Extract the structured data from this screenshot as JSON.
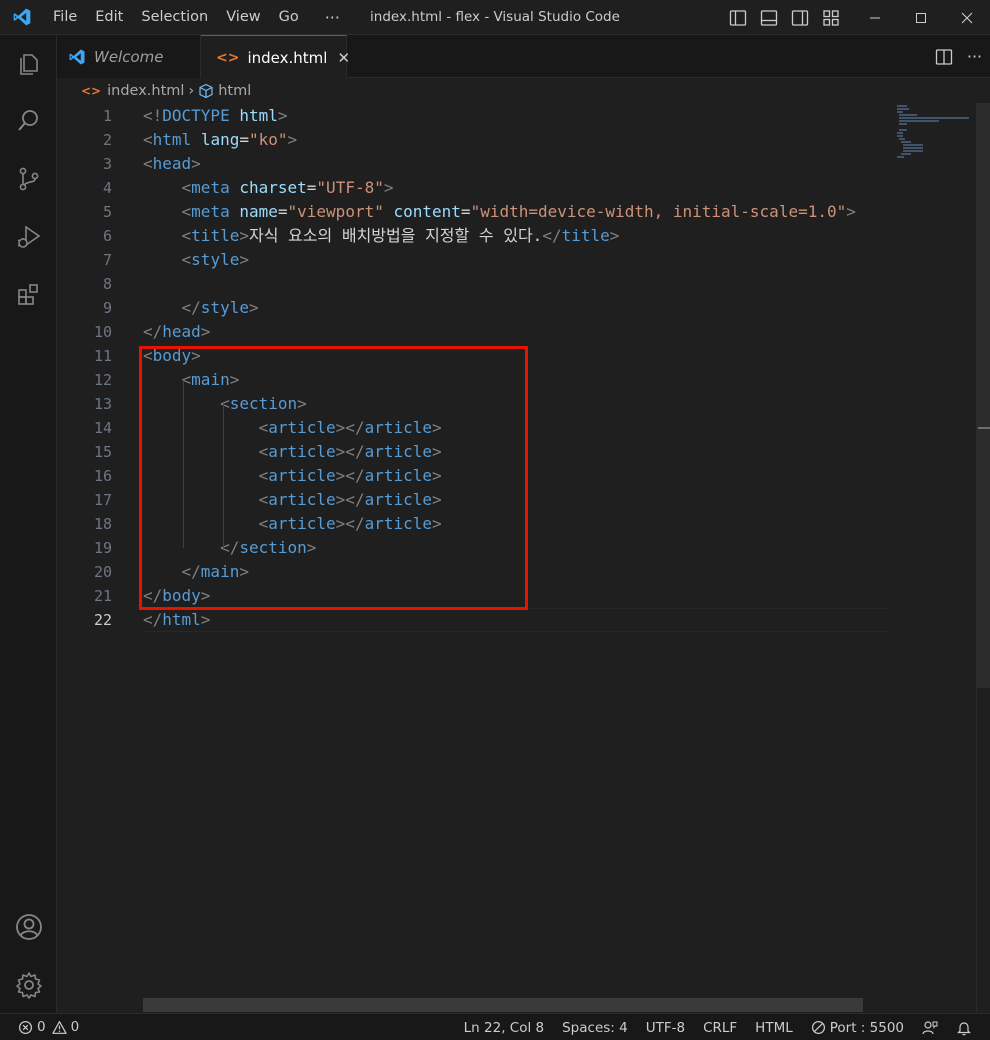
{
  "window": {
    "title": "index.html - flex - Visual Studio Code",
    "menu": [
      "File",
      "Edit",
      "Selection",
      "View",
      "Go"
    ],
    "more_menu": "···"
  },
  "tabs": [
    {
      "label": "Welcome",
      "icon": "vscode-logo-icon",
      "active": false
    },
    {
      "label": "index.html",
      "icon": "html-file-icon",
      "active": true,
      "close": "✕"
    }
  ],
  "breadcrumb": {
    "file": "index.html",
    "separator": "›",
    "symbol": "html"
  },
  "editor": {
    "active_line": 22,
    "line_numbers": [
      "1",
      "2",
      "3",
      "4",
      "5",
      "6",
      "7",
      "8",
      "9",
      "10",
      "11",
      "12",
      "13",
      "14",
      "15",
      "16",
      "17",
      "18",
      "19",
      "20",
      "21",
      "22"
    ],
    "lines": [
      [
        {
          "t": "<!",
          "c": "br"
        },
        {
          "t": "DOCTYPE",
          "c": "tg"
        },
        {
          "t": " ",
          "c": "tx"
        },
        {
          "t": "html",
          "c": "at"
        },
        {
          "t": ">",
          "c": "br"
        }
      ],
      [
        {
          "t": "<",
          "c": "br"
        },
        {
          "t": "html",
          "c": "tg"
        },
        {
          "t": " ",
          "c": "tx"
        },
        {
          "t": "lang",
          "c": "at"
        },
        {
          "t": "=",
          "c": "tx"
        },
        {
          "t": "\"ko\"",
          "c": "st"
        },
        {
          "t": ">",
          "c": "br"
        }
      ],
      [
        {
          "t": "<",
          "c": "br"
        },
        {
          "t": "head",
          "c": "tg"
        },
        {
          "t": ">",
          "c": "br"
        }
      ],
      [
        {
          "t": "    ",
          "c": "tx"
        },
        {
          "t": "<",
          "c": "br"
        },
        {
          "t": "meta",
          "c": "tg"
        },
        {
          "t": " ",
          "c": "tx"
        },
        {
          "t": "charset",
          "c": "at"
        },
        {
          "t": "=",
          "c": "tx"
        },
        {
          "t": "\"UTF-8\"",
          "c": "st"
        },
        {
          "t": ">",
          "c": "br"
        }
      ],
      [
        {
          "t": "    ",
          "c": "tx"
        },
        {
          "t": "<",
          "c": "br"
        },
        {
          "t": "meta",
          "c": "tg"
        },
        {
          "t": " ",
          "c": "tx"
        },
        {
          "t": "name",
          "c": "at"
        },
        {
          "t": "=",
          "c": "tx"
        },
        {
          "t": "\"viewport\"",
          "c": "st"
        },
        {
          "t": " ",
          "c": "tx"
        },
        {
          "t": "content",
          "c": "at"
        },
        {
          "t": "=",
          "c": "tx"
        },
        {
          "t": "\"width=device-width, initial-scale=1.0\"",
          "c": "st"
        },
        {
          "t": ">",
          "c": "br"
        }
      ],
      [
        {
          "t": "    ",
          "c": "tx"
        },
        {
          "t": "<",
          "c": "br"
        },
        {
          "t": "title",
          "c": "tg"
        },
        {
          "t": ">",
          "c": "br"
        },
        {
          "t": "자식 요소의 배치방법을 지정할 수 있다.",
          "c": "tx"
        },
        {
          "t": "</",
          "c": "br"
        },
        {
          "t": "title",
          "c": "tg"
        },
        {
          "t": ">",
          "c": "br"
        }
      ],
      [
        {
          "t": "    ",
          "c": "tx"
        },
        {
          "t": "<",
          "c": "br"
        },
        {
          "t": "style",
          "c": "tg"
        },
        {
          "t": ">",
          "c": "br"
        }
      ],
      [],
      [
        {
          "t": "    ",
          "c": "tx"
        },
        {
          "t": "</",
          "c": "br"
        },
        {
          "t": "style",
          "c": "tg"
        },
        {
          "t": ">",
          "c": "br"
        }
      ],
      [
        {
          "t": "</",
          "c": "br"
        },
        {
          "t": "head",
          "c": "tg"
        },
        {
          "t": ">",
          "c": "br"
        }
      ],
      [
        {
          "t": "<",
          "c": "br"
        },
        {
          "t": "body",
          "c": "tg"
        },
        {
          "t": ">",
          "c": "br"
        }
      ],
      [
        {
          "t": "    ",
          "c": "tx"
        },
        {
          "t": "<",
          "c": "br"
        },
        {
          "t": "main",
          "c": "tg"
        },
        {
          "t": ">",
          "c": "br"
        }
      ],
      [
        {
          "t": "        ",
          "c": "tx"
        },
        {
          "t": "<",
          "c": "br"
        },
        {
          "t": "section",
          "c": "tg"
        },
        {
          "t": ">",
          "c": "br"
        }
      ],
      [
        {
          "t": "            ",
          "c": "tx"
        },
        {
          "t": "<",
          "c": "br"
        },
        {
          "t": "article",
          "c": "tg"
        },
        {
          "t": "></",
          "c": "br"
        },
        {
          "t": "article",
          "c": "tg"
        },
        {
          "t": ">",
          "c": "br"
        }
      ],
      [
        {
          "t": "            ",
          "c": "tx"
        },
        {
          "t": "<",
          "c": "br"
        },
        {
          "t": "article",
          "c": "tg"
        },
        {
          "t": "></",
          "c": "br"
        },
        {
          "t": "article",
          "c": "tg"
        },
        {
          "t": ">",
          "c": "br"
        }
      ],
      [
        {
          "t": "            ",
          "c": "tx"
        },
        {
          "t": "<",
          "c": "br"
        },
        {
          "t": "article",
          "c": "tg"
        },
        {
          "t": "></",
          "c": "br"
        },
        {
          "t": "article",
          "c": "tg"
        },
        {
          "t": ">",
          "c": "br"
        }
      ],
      [
        {
          "t": "            ",
          "c": "tx"
        },
        {
          "t": "<",
          "c": "br"
        },
        {
          "t": "article",
          "c": "tg"
        },
        {
          "t": "></",
          "c": "br"
        },
        {
          "t": "article",
          "c": "tg"
        },
        {
          "t": ">",
          "c": "br"
        }
      ],
      [
        {
          "t": "            ",
          "c": "tx"
        },
        {
          "t": "<",
          "c": "br"
        },
        {
          "t": "article",
          "c": "tg"
        },
        {
          "t": "></",
          "c": "br"
        },
        {
          "t": "article",
          "c": "tg"
        },
        {
          "t": ">",
          "c": "br"
        }
      ],
      [
        {
          "t": "        ",
          "c": "tx"
        },
        {
          "t": "</",
          "c": "br"
        },
        {
          "t": "section",
          "c": "tg"
        },
        {
          "t": ">",
          "c": "br"
        }
      ],
      [
        {
          "t": "    ",
          "c": "tx"
        },
        {
          "t": "</",
          "c": "br"
        },
        {
          "t": "main",
          "c": "tg"
        },
        {
          "t": ">",
          "c": "br"
        }
      ],
      [
        {
          "t": "</",
          "c": "br"
        },
        {
          "t": "body",
          "c": "tg"
        },
        {
          "t": ">",
          "c": "br"
        }
      ],
      [
        {
          "t": "</",
          "c": "br"
        },
        {
          "t": "html",
          "c": "tg"
        },
        {
          "t": ">",
          "c": "br"
        }
      ]
    ]
  },
  "statusbar": {
    "errors": "0",
    "warnings": "0",
    "position": "Ln 22, Col 8",
    "spaces": "Spaces: 4",
    "encoding": "UTF-8",
    "eol": "CRLF",
    "language": "HTML",
    "port": "Port : 5500"
  },
  "colors": {
    "highlight_box": "#e51400",
    "tag": "#569cd6",
    "attribute": "#9cdcfe",
    "string": "#ce9178",
    "bracket": "#808080",
    "text": "#d4d4d4"
  }
}
